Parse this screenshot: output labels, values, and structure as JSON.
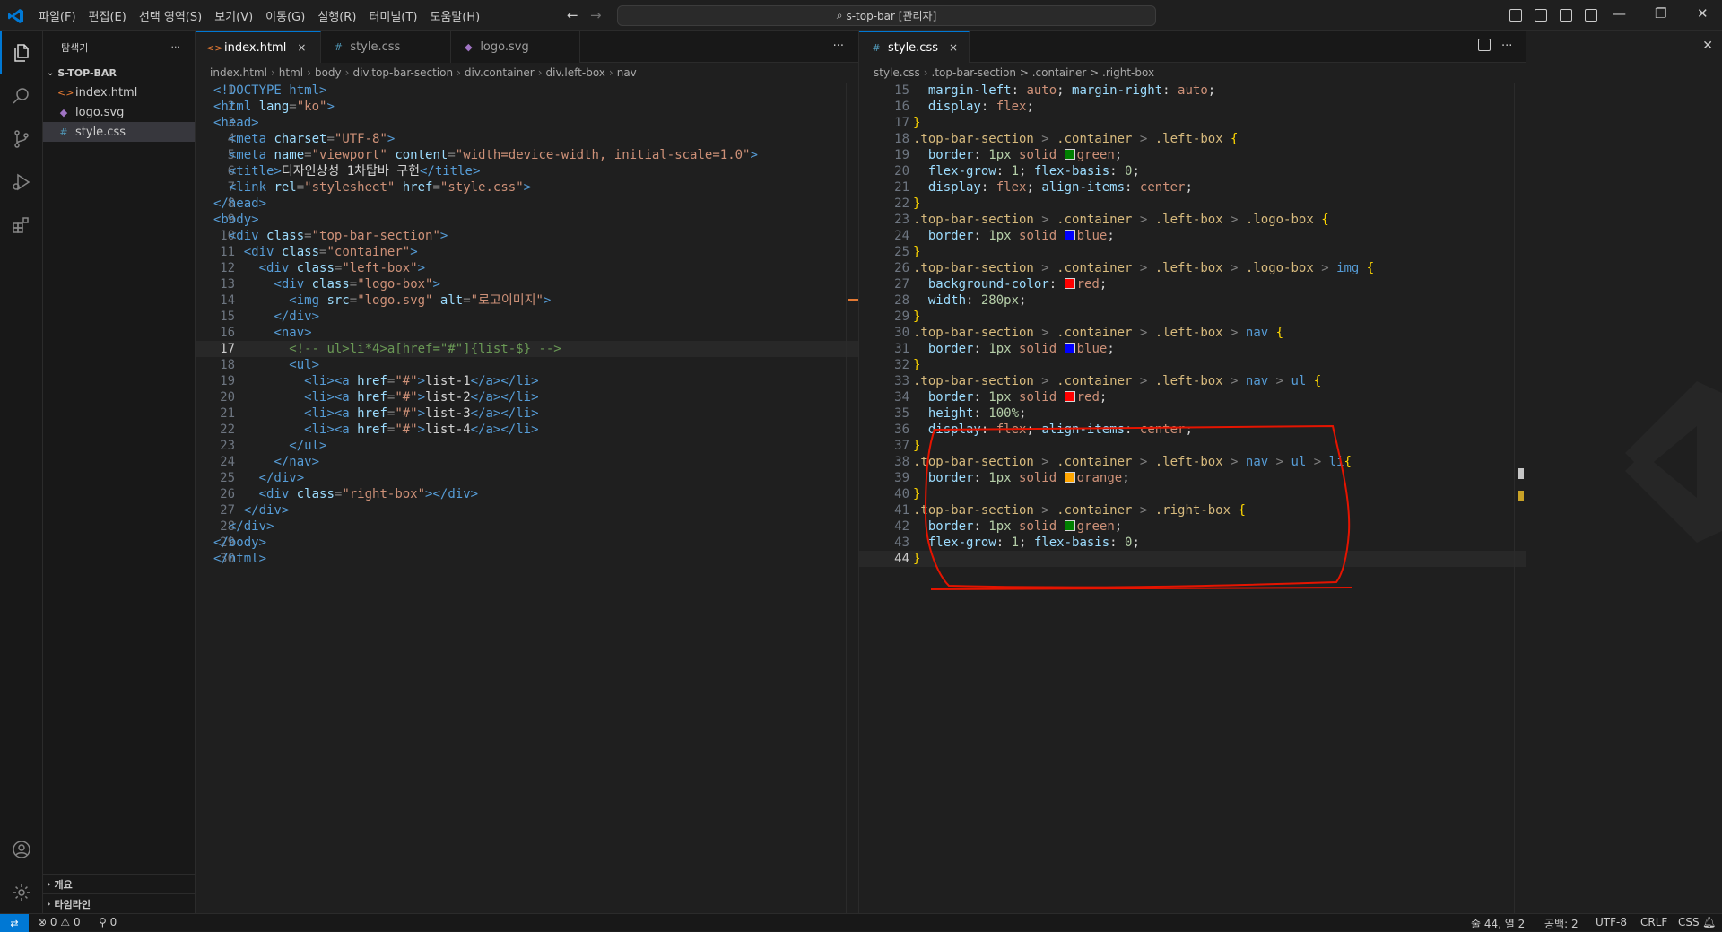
{
  "menus": [
    "파일(F)",
    "편집(E)",
    "선택 영역(S)",
    "보기(V)",
    "이동(G)",
    "실행(R)",
    "터미널(T)",
    "도움말(H)"
  ],
  "command_center": "s-top-bar [관리자]",
  "sidebar": {
    "title": "탐색기",
    "more": "···",
    "folder": "S-TOP-BAR",
    "files": [
      {
        "name": "index.html",
        "icon": "<>",
        "color": "#e37933"
      },
      {
        "name": "logo.svg",
        "icon": "◆",
        "color": "#a074c4"
      },
      {
        "name": "style.css",
        "icon": "#",
        "color": "#519aba"
      }
    ],
    "outline": "개요",
    "timeline": "타임라인"
  },
  "left_editor": {
    "tabs": [
      {
        "name": "index.html",
        "icon": "<>",
        "color": "#e37933",
        "close": "×"
      },
      {
        "name": "style.css",
        "icon": "#",
        "color": "#519aba",
        "close": ""
      },
      {
        "name": "logo.svg",
        "icon": "◆",
        "color": "#a074c4",
        "close": ""
      }
    ],
    "more": "···",
    "breadcrumb": [
      "index.html",
      "html",
      "body",
      "div.top-bar-section",
      "div.container",
      "div.left-box",
      "nav"
    ]
  },
  "right_editor": {
    "tab": {
      "name": "style.css",
      "icon": "#",
      "close": "×"
    },
    "breadcrumb": [
      "style.css",
      ".top-bar-section > .container > .right-box"
    ]
  },
  "html_lines": [
    [
      [
        "t-tag",
        "<!DOCTYPE html>"
      ]
    ],
    [
      [
        "t-tag",
        "<html "
      ],
      [
        "t-attr",
        "lang"
      ],
      [
        "t-punc",
        "="
      ],
      [
        "t-str",
        "\"ko\""
      ],
      [
        "t-tag",
        ">"
      ]
    ],
    [
      [
        "t-tag",
        "<head>"
      ]
    ],
    [
      [
        "t-txt",
        "  "
      ],
      [
        "t-tag",
        "<meta "
      ],
      [
        "t-attr",
        "charset"
      ],
      [
        "t-punc",
        "="
      ],
      [
        "t-str",
        "\"UTF-8\""
      ],
      [
        "t-tag",
        ">"
      ]
    ],
    [
      [
        "t-txt",
        "  "
      ],
      [
        "t-tag",
        "<meta "
      ],
      [
        "t-attr",
        "name"
      ],
      [
        "t-punc",
        "="
      ],
      [
        "t-str",
        "\"viewport\" "
      ],
      [
        "t-attr",
        "content"
      ],
      [
        "t-punc",
        "="
      ],
      [
        "t-str",
        "\"width=device-width, initial-scale=1.0\""
      ],
      [
        "t-tag",
        ">"
      ]
    ],
    [
      [
        "t-txt",
        "  "
      ],
      [
        "t-tag",
        "<title>"
      ],
      [
        "t-txt",
        "디자인상성 1차탑바 구현"
      ],
      [
        "t-tag",
        "</title>"
      ]
    ],
    [
      [
        "t-txt",
        "  "
      ],
      [
        "t-tag",
        "<link "
      ],
      [
        "t-attr",
        "rel"
      ],
      [
        "t-punc",
        "="
      ],
      [
        "t-str",
        "\"stylesheet\" "
      ],
      [
        "t-attr",
        "href"
      ],
      [
        "t-punc",
        "="
      ],
      [
        "t-str",
        "\"style.css\""
      ],
      [
        "t-tag",
        ">"
      ]
    ],
    [
      [
        "t-tag",
        "</head>"
      ]
    ],
    [
      [
        "t-tag",
        "<body>"
      ]
    ],
    [
      [
        "t-txt",
        "  "
      ],
      [
        "t-tag",
        "<div "
      ],
      [
        "t-attr",
        "class"
      ],
      [
        "t-punc",
        "="
      ],
      [
        "t-str",
        "\"top-bar-section\""
      ],
      [
        "t-tag",
        ">"
      ]
    ],
    [
      [
        "t-txt",
        "    "
      ],
      [
        "t-tag",
        "<div "
      ],
      [
        "t-attr",
        "class"
      ],
      [
        "t-punc",
        "="
      ],
      [
        "t-str",
        "\"container\""
      ],
      [
        "t-tag",
        ">"
      ]
    ],
    [
      [
        "t-txt",
        "      "
      ],
      [
        "t-tag",
        "<div "
      ],
      [
        "t-attr",
        "class"
      ],
      [
        "t-punc",
        "="
      ],
      [
        "t-str",
        "\"left-box\""
      ],
      [
        "t-tag",
        ">"
      ]
    ],
    [
      [
        "t-txt",
        "        "
      ],
      [
        "t-tag",
        "<div "
      ],
      [
        "t-attr",
        "class"
      ],
      [
        "t-punc",
        "="
      ],
      [
        "t-str",
        "\"logo-box\""
      ],
      [
        "t-tag",
        ">"
      ]
    ],
    [
      [
        "t-txt",
        "          "
      ],
      [
        "t-tag",
        "<img "
      ],
      [
        "t-attr",
        "src"
      ],
      [
        "t-punc",
        "="
      ],
      [
        "t-str",
        "\"logo.svg\" "
      ],
      [
        "t-attr",
        "alt"
      ],
      [
        "t-punc",
        "="
      ],
      [
        "t-str",
        "\"로고이미지\""
      ],
      [
        "t-tag",
        ">"
      ]
    ],
    [
      [
        "t-txt",
        "        "
      ],
      [
        "t-tag",
        "</div>"
      ]
    ],
    [
      [
        "t-txt",
        "        "
      ],
      [
        "t-tag",
        "<nav>"
      ]
    ],
    [
      [
        "t-txt",
        "          "
      ],
      [
        "t-com",
        "<!-- ul>li*4>a[href=\"#\"]{list-$} -->"
      ]
    ],
    [
      [
        "t-txt",
        "          "
      ],
      [
        "t-tag",
        "<ul>"
      ]
    ],
    [
      [
        "t-txt",
        "            "
      ],
      [
        "t-tag",
        "<li><a "
      ],
      [
        "t-attr",
        "href"
      ],
      [
        "t-punc",
        "="
      ],
      [
        "t-str",
        "\"#\""
      ],
      [
        "t-tag",
        ">"
      ],
      [
        "t-txt",
        "list-1"
      ],
      [
        "t-tag",
        "</a></li>"
      ]
    ],
    [
      [
        "t-txt",
        "            "
      ],
      [
        "t-tag",
        "<li><a "
      ],
      [
        "t-attr",
        "href"
      ],
      [
        "t-punc",
        "="
      ],
      [
        "t-str",
        "\"#\""
      ],
      [
        "t-tag",
        ">"
      ],
      [
        "t-txt",
        "list-2"
      ],
      [
        "t-tag",
        "</a></li>"
      ]
    ],
    [
      [
        "t-txt",
        "            "
      ],
      [
        "t-tag",
        "<li><a "
      ],
      [
        "t-attr",
        "href"
      ],
      [
        "t-punc",
        "="
      ],
      [
        "t-str",
        "\"#\""
      ],
      [
        "t-tag",
        ">"
      ],
      [
        "t-txt",
        "list-3"
      ],
      [
        "t-tag",
        "</a></li>"
      ]
    ],
    [
      [
        "t-txt",
        "            "
      ],
      [
        "t-tag",
        "<li><a "
      ],
      [
        "t-attr",
        "href"
      ],
      [
        "t-punc",
        "="
      ],
      [
        "t-str",
        "\"#\""
      ],
      [
        "t-tag",
        ">"
      ],
      [
        "t-txt",
        "list-4"
      ],
      [
        "t-tag",
        "</a></li>"
      ]
    ],
    [
      [
        "t-txt",
        "          "
      ],
      [
        "t-tag",
        "</ul>"
      ]
    ],
    [
      [
        "t-txt",
        "        "
      ],
      [
        "t-tag",
        "</nav>"
      ]
    ],
    [
      [
        "t-txt",
        "      "
      ],
      [
        "t-tag",
        "</div>"
      ]
    ],
    [
      [
        "t-txt",
        "      "
      ],
      [
        "t-tag",
        "<div "
      ],
      [
        "t-attr",
        "class"
      ],
      [
        "t-punc",
        "="
      ],
      [
        "t-str",
        "\"right-box\""
      ],
      [
        "t-tag",
        "></div>"
      ]
    ],
    [
      [
        "t-txt",
        "    "
      ],
      [
        "t-tag",
        "</div>"
      ]
    ],
    [
      [
        "t-txt",
        "  "
      ],
      [
        "t-tag",
        "</div>"
      ]
    ],
    [
      [
        "t-tag",
        "</body>"
      ]
    ],
    [
      [
        "t-tag",
        "</html>"
      ]
    ]
  ],
  "html_first_line": 1,
  "html_current_line": 17,
  "css_lines": [
    [
      [
        "t-txt",
        "  "
      ],
      [
        "t-prop",
        "margin-left"
      ],
      [
        "t-txt",
        ": "
      ],
      [
        "t-val",
        "auto"
      ],
      [
        "t-txt",
        "; "
      ],
      [
        "t-prop",
        "margin-right"
      ],
      [
        "t-txt",
        ": "
      ],
      [
        "t-val",
        "auto"
      ],
      [
        "t-txt",
        ";"
      ]
    ],
    [
      [
        "t-txt",
        "  "
      ],
      [
        "t-prop",
        "display"
      ],
      [
        "t-txt",
        ": "
      ],
      [
        "t-val",
        "flex"
      ],
      [
        "t-txt",
        ";"
      ]
    ],
    [
      [
        "t-br",
        "}"
      ]
    ],
    [
      [
        "t-sel",
        ".top-bar-section"
      ],
      [
        "t-punc",
        " > "
      ],
      [
        "t-sel",
        ".container"
      ],
      [
        "t-punc",
        " > "
      ],
      [
        "t-sel",
        ".left-box "
      ],
      [
        "t-br",
        "{"
      ]
    ],
    [
      [
        "t-txt",
        "  "
      ],
      [
        "t-prop",
        "border"
      ],
      [
        "t-txt",
        ": "
      ],
      [
        "t-num",
        "1px"
      ],
      [
        "t-val",
        " solid "
      ],
      [
        "sw",
        "#008000"
      ],
      [
        "t-val",
        "green"
      ],
      [
        "t-txt",
        ";"
      ]
    ],
    [
      [
        "t-txt",
        "  "
      ],
      [
        "t-prop",
        "flex-grow"
      ],
      [
        "t-txt",
        ": "
      ],
      [
        "t-num",
        "1"
      ],
      [
        "t-txt",
        "; "
      ],
      [
        "t-prop",
        "flex-basis"
      ],
      [
        "t-txt",
        ": "
      ],
      [
        "t-num",
        "0"
      ],
      [
        "t-txt",
        ";"
      ]
    ],
    [
      [
        "t-txt",
        "  "
      ],
      [
        "t-prop",
        "display"
      ],
      [
        "t-txt",
        ": "
      ],
      [
        "t-val",
        "flex"
      ],
      [
        "t-txt",
        "; "
      ],
      [
        "t-prop",
        "align-items"
      ],
      [
        "t-txt",
        ": "
      ],
      [
        "t-val",
        "center"
      ],
      [
        "t-txt",
        ";"
      ]
    ],
    [
      [
        "t-br",
        "}"
      ]
    ],
    [
      [
        "t-sel",
        ".top-bar-section"
      ],
      [
        "t-punc",
        " > "
      ],
      [
        "t-sel",
        ".container"
      ],
      [
        "t-punc",
        " > "
      ],
      [
        "t-sel",
        ".left-box"
      ],
      [
        "t-punc",
        " > "
      ],
      [
        "t-sel",
        ".logo-box "
      ],
      [
        "t-br",
        "{"
      ]
    ],
    [
      [
        "t-txt",
        "  "
      ],
      [
        "t-prop",
        "border"
      ],
      [
        "t-txt",
        ": "
      ],
      [
        "t-num",
        "1px"
      ],
      [
        "t-val",
        " solid "
      ],
      [
        "sw",
        "#0000ff"
      ],
      [
        "t-val",
        "blue"
      ],
      [
        "t-txt",
        ";"
      ]
    ],
    [
      [
        "t-br",
        "}"
      ]
    ],
    [
      [
        "t-sel",
        ".top-bar-section"
      ],
      [
        "t-punc",
        " > "
      ],
      [
        "t-sel",
        ".container"
      ],
      [
        "t-punc",
        " > "
      ],
      [
        "t-sel",
        ".left-box"
      ],
      [
        "t-punc",
        " > "
      ],
      [
        "t-sel",
        ".logo-box"
      ],
      [
        "t-punc",
        " > "
      ],
      [
        "t-tag",
        "img "
      ],
      [
        "t-br",
        "{"
      ]
    ],
    [
      [
        "t-txt",
        "  "
      ],
      [
        "t-prop",
        "background-color"
      ],
      [
        "t-txt",
        ": "
      ],
      [
        "sw",
        "#ff0000"
      ],
      [
        "t-val",
        "red"
      ],
      [
        "t-txt",
        ";"
      ]
    ],
    [
      [
        "t-txt",
        "  "
      ],
      [
        "t-prop",
        "width"
      ],
      [
        "t-txt",
        ": "
      ],
      [
        "t-num",
        "280px"
      ],
      [
        "t-txt",
        ";"
      ]
    ],
    [
      [
        "t-br",
        "}"
      ]
    ],
    [
      [
        "t-sel",
        ".top-bar-section"
      ],
      [
        "t-punc",
        " > "
      ],
      [
        "t-sel",
        ".container"
      ],
      [
        "t-punc",
        " > "
      ],
      [
        "t-sel",
        ".left-box"
      ],
      [
        "t-punc",
        " > "
      ],
      [
        "t-tag",
        "nav "
      ],
      [
        "t-br",
        "{"
      ]
    ],
    [
      [
        "t-txt",
        "  "
      ],
      [
        "t-prop",
        "border"
      ],
      [
        "t-txt",
        ": "
      ],
      [
        "t-num",
        "1px"
      ],
      [
        "t-val",
        " solid "
      ],
      [
        "sw",
        "#0000ff"
      ],
      [
        "t-val",
        "blue"
      ],
      [
        "t-txt",
        ";"
      ]
    ],
    [
      [
        "t-br",
        "}"
      ]
    ],
    [
      [
        "t-sel",
        ".top-bar-section"
      ],
      [
        "t-punc",
        " > "
      ],
      [
        "t-sel",
        ".container"
      ],
      [
        "t-punc",
        " > "
      ],
      [
        "t-sel",
        ".left-box"
      ],
      [
        "t-punc",
        " > "
      ],
      [
        "t-tag",
        "nav"
      ],
      [
        "t-punc",
        " > "
      ],
      [
        "t-tag",
        "ul "
      ],
      [
        "t-br",
        "{"
      ]
    ],
    [
      [
        "t-txt",
        "  "
      ],
      [
        "t-prop",
        "border"
      ],
      [
        "t-txt",
        ": "
      ],
      [
        "t-num",
        "1px"
      ],
      [
        "t-val",
        " solid "
      ],
      [
        "sw",
        "#ff0000"
      ],
      [
        "t-val",
        "red"
      ],
      [
        "t-txt",
        ";"
      ]
    ],
    [
      [
        "t-txt",
        "  "
      ],
      [
        "t-prop",
        "height"
      ],
      [
        "t-txt",
        ": "
      ],
      [
        "t-num",
        "100%"
      ],
      [
        "t-txt",
        ";"
      ]
    ],
    [
      [
        "t-txt",
        "  "
      ],
      [
        "t-prop",
        "display"
      ],
      [
        "t-txt",
        ": "
      ],
      [
        "t-val",
        "flex"
      ],
      [
        "t-txt",
        "; "
      ],
      [
        "t-prop",
        "align-items"
      ],
      [
        "t-txt",
        ": "
      ],
      [
        "t-val",
        "center"
      ],
      [
        "t-txt",
        ";"
      ]
    ],
    [
      [
        "t-br",
        "}"
      ]
    ],
    [
      [
        "t-sel",
        ".top-bar-section"
      ],
      [
        "t-punc",
        " > "
      ],
      [
        "t-sel",
        ".container"
      ],
      [
        "t-punc",
        " > "
      ],
      [
        "t-sel",
        ".left-box"
      ],
      [
        "t-punc",
        " > "
      ],
      [
        "t-tag",
        "nav"
      ],
      [
        "t-punc",
        " > "
      ],
      [
        "t-tag",
        "ul"
      ],
      [
        "t-punc",
        " > "
      ],
      [
        "t-tag",
        "li"
      ],
      [
        "t-br",
        "{"
      ]
    ],
    [
      [
        "t-txt",
        "  "
      ],
      [
        "t-prop",
        "border"
      ],
      [
        "t-txt",
        ": "
      ],
      [
        "t-num",
        "1px"
      ],
      [
        "t-val",
        " solid "
      ],
      [
        "sw",
        "#ffa500"
      ],
      [
        "t-val",
        "orange"
      ],
      [
        "t-txt",
        ";"
      ]
    ],
    [
      [
        "t-br",
        "}"
      ]
    ],
    [
      [
        "t-sel",
        ".top-bar-section"
      ],
      [
        "t-punc",
        " > "
      ],
      [
        "t-sel",
        ".container"
      ],
      [
        "t-punc",
        " > "
      ],
      [
        "t-sel",
        ".right-box "
      ],
      [
        "t-br",
        "{"
      ]
    ],
    [
      [
        "t-txt",
        "  "
      ],
      [
        "t-prop",
        "border"
      ],
      [
        "t-txt",
        ": "
      ],
      [
        "t-num",
        "1px"
      ],
      [
        "t-val",
        " solid "
      ],
      [
        "sw",
        "#008000"
      ],
      [
        "t-val",
        "green"
      ],
      [
        "t-txt",
        ";"
      ]
    ],
    [
      [
        "t-txt",
        "  "
      ],
      [
        "t-prop",
        "flex-grow"
      ],
      [
        "t-txt",
        ": "
      ],
      [
        "t-num",
        "1"
      ],
      [
        "t-txt",
        "; "
      ],
      [
        "t-prop",
        "flex-basis"
      ],
      [
        "t-txt",
        ": "
      ],
      [
        "t-num",
        "0"
      ],
      [
        "t-txt",
        ";"
      ]
    ],
    [
      [
        "t-br",
        "}"
      ]
    ]
  ],
  "css_first_line": 15,
  "css_current_line": 44,
  "statusbar": {
    "errors": "0",
    "warnings": "0",
    "ports": "0",
    "position": "줄 44, 열 2",
    "spaces": "공백: 2",
    "encoding": "UTF-8",
    "eol": "CRLF",
    "language": "CSS"
  },
  "colors": {
    "accent": "#0078d4",
    "annotation": "#e51400"
  }
}
